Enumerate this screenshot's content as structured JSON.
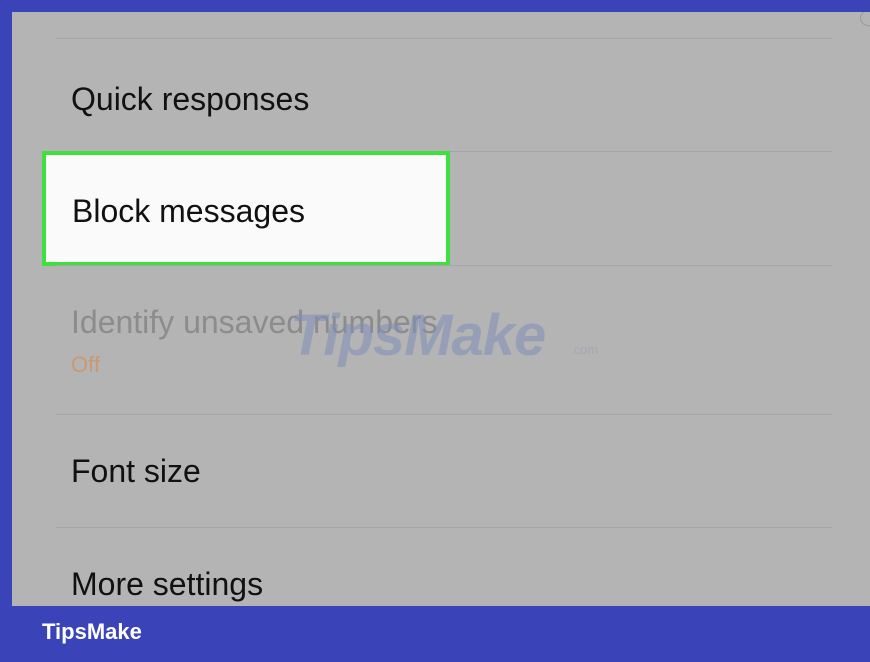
{
  "settings": {
    "items": [
      {
        "label": "Quick responses"
      },
      {
        "label": "Block messages"
      },
      {
        "label": "Identify unsaved numbers",
        "sublabel": "Off"
      },
      {
        "label": "Font size"
      },
      {
        "label": "More settings"
      }
    ]
  },
  "watermark": {
    "text": "TipsMake",
    "suffix": ".com"
  },
  "footer": {
    "brand": "TipsMake"
  },
  "colors": {
    "frame": "#3a44b8",
    "highlight_border": "#3ee03e",
    "dim_overlay": "#b4b4b4"
  }
}
